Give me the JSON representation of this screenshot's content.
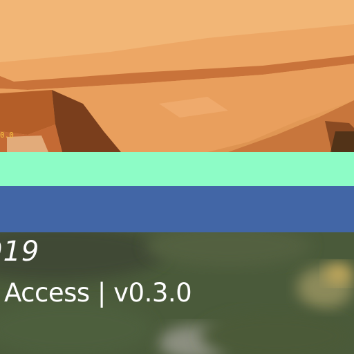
{
  "hud": {
    "corner_value": "0.0"
  },
  "splash": {
    "year_text": "019",
    "version_line": "Access | v0.3.0"
  },
  "colors": {
    "sand": "#e8a05c",
    "rock_shadow": "#7a3e1c",
    "mint_band": "#8dfcc6",
    "blue_band": "#4266a6",
    "terrain": "#475738",
    "text": "#ffffff",
    "hud_text": "#f5c040"
  }
}
